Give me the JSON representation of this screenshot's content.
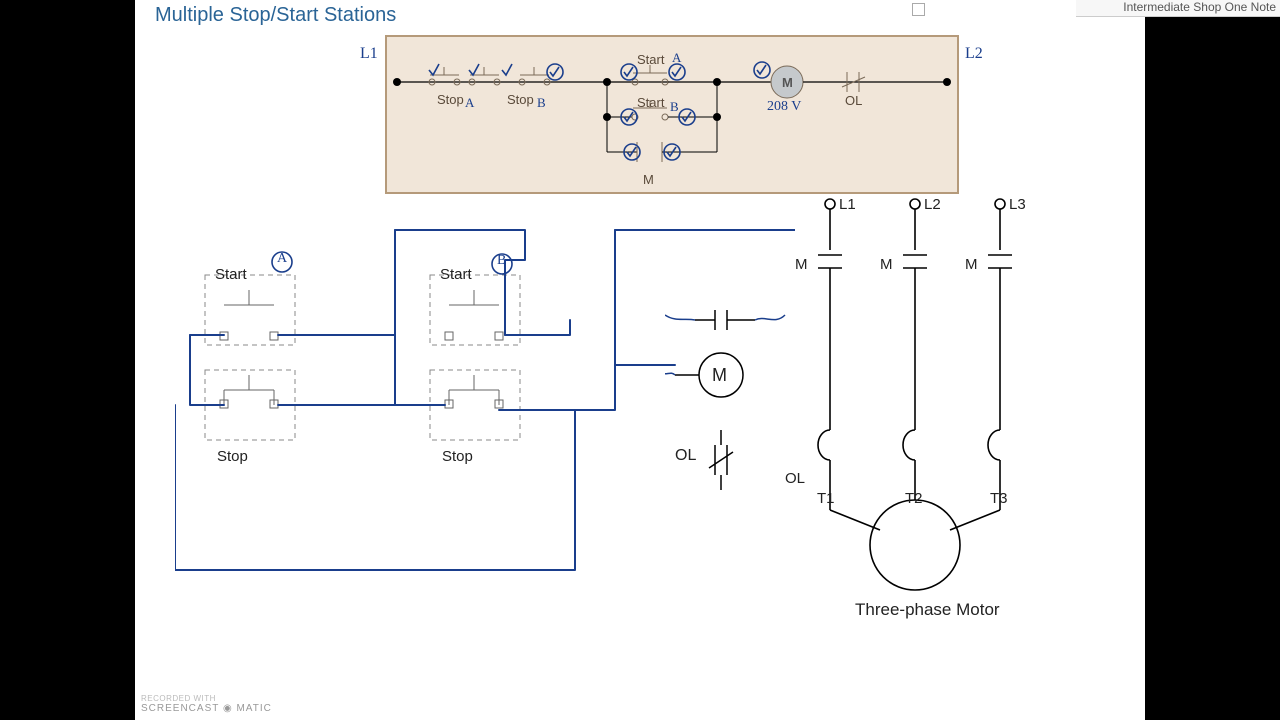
{
  "meta": {
    "title": "Multiple Stop/Start Stations",
    "sideTab": "Intermediate Shop One Note",
    "watermark_line1": "Recorded with",
    "watermark_line2": "SCREENCAST ◉ MATIC"
  },
  "top_diagram": {
    "lines": {
      "L1": "L1",
      "L2": "L2"
    },
    "stops": {
      "stopA_label": "Stop",
      "stopA_sub": "A",
      "stopB_label": "Stop",
      "stopB_sub": "B"
    },
    "starts": {
      "top_label": "Start",
      "top_sub": "A",
      "mid_label": "Start",
      "mid_sub": "B"
    },
    "coil": {
      "M": "M",
      "voltage": "208 V"
    },
    "overload": "OL",
    "aux_contact": "M"
  },
  "annotations": {
    "stationA": "A",
    "stationB": "B"
  },
  "station_boxes": {
    "start": "Start",
    "stop": "Stop"
  },
  "control": {
    "coil": "M",
    "overload": "OL"
  },
  "power_diagram": {
    "lines": [
      "L1",
      "L2",
      "L3"
    ],
    "contacts": [
      "M",
      "M",
      "M"
    ],
    "overloads_label": "OL",
    "terminals": [
      "T1",
      "T2",
      "T3"
    ],
    "motor_label": "Three-phase Motor"
  }
}
